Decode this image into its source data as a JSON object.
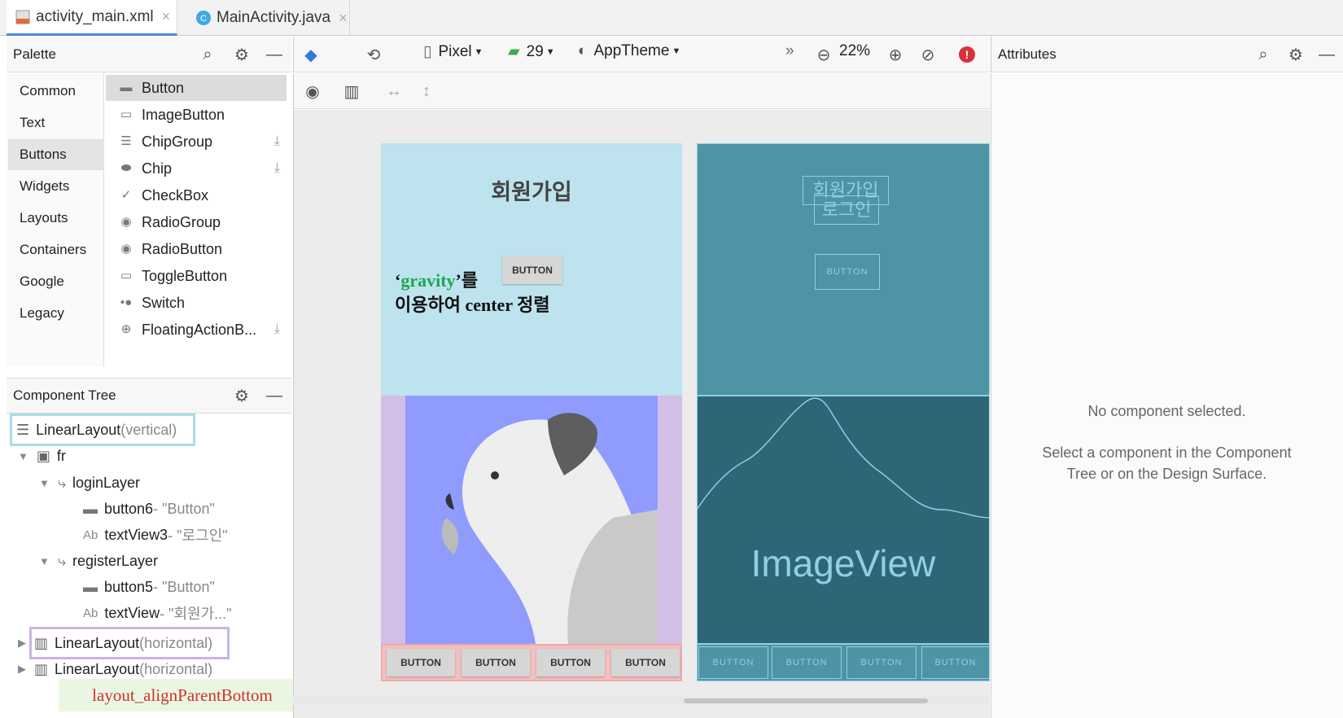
{
  "tabs": [
    {
      "label": "activity_main.xml",
      "close": "×"
    },
    {
      "label": "MainActivity.java",
      "close": "×"
    }
  ],
  "palette": {
    "title": "Palette",
    "categories": [
      "Common",
      "Text",
      "Buttons",
      "Widgets",
      "Layouts",
      "Containers",
      "Google",
      "Legacy"
    ],
    "items": [
      "Button",
      "ImageButton",
      "ChipGroup",
      "Chip",
      "CheckBox",
      "RadioGroup",
      "RadioButton",
      "ToggleButton",
      "Switch",
      "FloatingActionB..."
    ]
  },
  "toolbar": {
    "device": "Pixel",
    "api": "29",
    "theme": "AppTheme",
    "zoom": "22%",
    "more": "»"
  },
  "component_tree": {
    "title": "Component Tree",
    "root": {
      "name": "LinearLayout",
      "detail": "(vertical)"
    },
    "fr": "fr",
    "loginLayer": "loginLayer",
    "button6": {
      "name": "button6",
      "detail": "- \"Button\""
    },
    "textView3": {
      "name": "textView3",
      "detail": "- \"로그인\""
    },
    "registerLayer": "registerLayer",
    "button5": {
      "name": "button5",
      "detail": "- \"Button\""
    },
    "textView": {
      "name": "textView",
      "detail": "- \"회원가...\""
    },
    "ll_h1": {
      "name": "LinearLayout",
      "detail": "(horizontal)"
    },
    "ll_h2": {
      "name": "LinearLayout",
      "detail": "(horizontal)"
    },
    "ab": "Ab"
  },
  "design": {
    "title": "회원가입",
    "button": "BUTTON",
    "annotation_q1": "‘",
    "annotation_word": "gravity",
    "annotation_q2": "’를",
    "annotation_line2": "이용하여 center 정렬",
    "bottom_buttons": [
      "BUTTON",
      "BUTTON",
      "BUTTON",
      "BUTTON"
    ],
    "annotation_bottom": "layout_alignParentBottom"
  },
  "blueprint": {
    "title1": "회원가입",
    "title2": "로그인",
    "button": "BUTTON",
    "image_label": "ImageView",
    "bottom_buttons": [
      "BUTTON",
      "BUTTON",
      "BUTTON",
      "BUTTON"
    ]
  },
  "attributes": {
    "title": "Attributes",
    "empty_title": "No component selected.",
    "empty_line1": "Select a component in the Component",
    "empty_line2": "Tree or on the Design Surface."
  },
  "colors": {
    "accent": "#4a8ad8",
    "error": "#d9313a",
    "design_bg": "#bde3ee",
    "image_bg": "#8f9cfd",
    "blueprint": "#4f93a6",
    "annotation_green": "#1aa84c",
    "annotation_red": "#d03030"
  }
}
